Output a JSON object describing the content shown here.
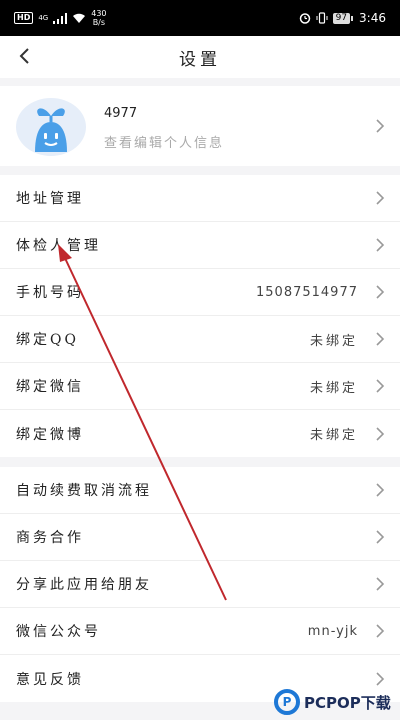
{
  "status_bar": {
    "hd": "HD",
    "net": "4G",
    "speed_value": "430",
    "speed_unit": "B/s",
    "battery": "97",
    "time": "3:46"
  },
  "nav": {
    "title": "设置"
  },
  "profile": {
    "name": "4977",
    "subtitle": "查看编辑个人信息"
  },
  "groups": [
    {
      "items": [
        {
          "label": "地址管理",
          "value": ""
        },
        {
          "label": "体检人管理",
          "value": ""
        },
        {
          "label": "手机号码",
          "value": "15087514977"
        },
        {
          "label": "绑定QQ",
          "value": "未绑定"
        },
        {
          "label": "绑定微信",
          "value": "未绑定"
        },
        {
          "label": "绑定微博",
          "value": "未绑定"
        }
      ]
    },
    {
      "items": [
        {
          "label": "自动续费取消流程",
          "value": ""
        },
        {
          "label": "商务合作",
          "value": ""
        },
        {
          "label": "分享此应用给朋友",
          "value": ""
        },
        {
          "label": "微信公众号",
          "value": "mn-yjk"
        },
        {
          "label": "意见反馈",
          "value": ""
        }
      ]
    }
  ],
  "watermark": {
    "logo": "P",
    "text": "PCPOP下载"
  },
  "colors": {
    "accent_blue": "#4a9fe8",
    "annotation_arrow": "#c0282d"
  }
}
